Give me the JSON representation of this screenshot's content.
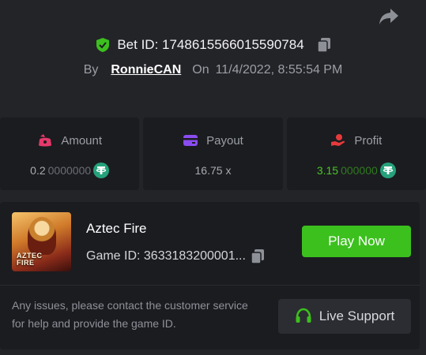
{
  "bet": {
    "id_label": "Bet ID: 1748615566015590784",
    "by_label": "By",
    "username": "RonnieCAN",
    "on_label": "On",
    "datetime": "11/4/2022, 8:55:54 PM"
  },
  "stats": {
    "amount": {
      "label": "Amount",
      "value_main": "0.2",
      "value_dim": "0000000",
      "icon": "bag-icon"
    },
    "payout": {
      "label": "Payout",
      "value": "16.75 x",
      "icon": "card-icon"
    },
    "profit": {
      "label": "Profit",
      "value_main": "3.15",
      "value_dim": "000000",
      "icon": "hand-coin-icon"
    }
  },
  "game": {
    "name": "Aztec Fire",
    "game_id": "Game ID: 3633183200001...",
    "thumb_text_1": "AZTEC",
    "thumb_text_2": "FIRE",
    "play_label": "Play Now"
  },
  "support": {
    "text": "Any issues, please contact the customer service for help and provide the game ID.",
    "button_label": "Live Support"
  },
  "colors": {
    "background": "#232428",
    "card": "#1b1c20",
    "accent_green": "#3cc01e",
    "profit_green": "#49c624",
    "tether": "#26a17b"
  }
}
